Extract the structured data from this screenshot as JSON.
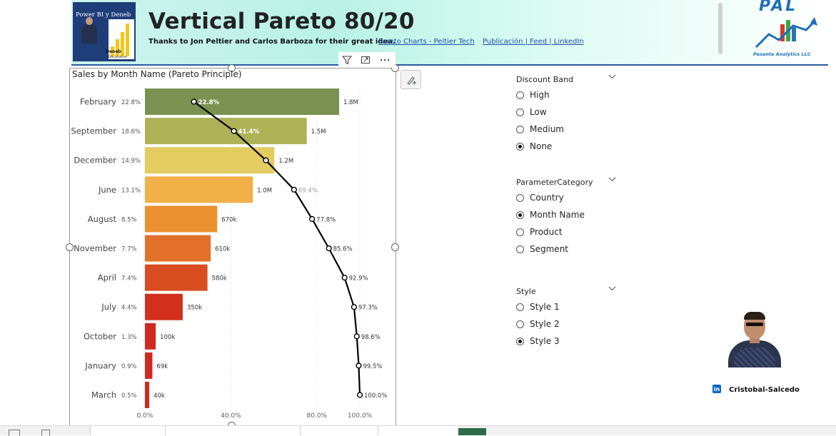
{
  "header": {
    "title": "Vertical Pareto 80/20",
    "subtitle": "Thanks to Jon Peltier and Carlos Barboza for their great idea.",
    "link1": "Pareto Charts - Peltier Tech",
    "link2": "Publicación | Feed | LinkedIn",
    "thumb_title": "Power BI y Deneb",
    "thumb_deneb": "Deneb",
    "thumb_deneb_sub": "Declarative",
    "logo_text": "PAL",
    "logo_sub": "Pesante Analytics LLC"
  },
  "visual": {
    "title": "Sales by Month Name (Pareto Principle)"
  },
  "chart_data": {
    "type": "bar",
    "title": "Sales by Month Name (Pareto Principle)",
    "categories": [
      "February",
      "September",
      "December",
      "June",
      "August",
      "November",
      "April",
      "July",
      "October",
      "January",
      "March"
    ],
    "share_labels": [
      "22.8%",
      "18.6%",
      "14.9%",
      "13.1%",
      "8.5%",
      "7.7%",
      "7.4%",
      "4.4%",
      "1.3%",
      "0.9%",
      "0.5%"
    ],
    "values": [
      1800000,
      1500000,
      1200000,
      1000000,
      670000,
      610000,
      580000,
      350000,
      100000,
      69000,
      40000
    ],
    "value_labels": [
      "1.8M",
      "1.5M",
      "1.2M",
      "1.0M",
      "670k",
      "610k",
      "580k",
      "350k",
      "100k",
      "69k",
      "40k"
    ],
    "cumulative": [
      22.8,
      41.4,
      56.3,
      69.4,
      77.8,
      85.6,
      92.9,
      97.3,
      98.6,
      99.5,
      100.0
    ],
    "cumulative_labels": [
      "22.8%",
      "41.4%",
      "",
      "69.4%",
      "77.8%",
      "85.6%",
      "92.9%",
      "97.3%",
      "98.6%",
      "99.5%",
      "100.0%"
    ],
    "x_ticks": [
      "0.0%",
      "40.0%",
      "80.0%",
      "100.0%"
    ],
    "x_tick_values": [
      0,
      40,
      80,
      100
    ],
    "xlim": [
      0,
      100
    ],
    "grid": true,
    "colors": [
      "#7a9150",
      "#adb257",
      "#e3cc60",
      "#f1b048",
      "#ec9130",
      "#e3702a",
      "#d94e20",
      "#d1301d",
      "#cf2a20",
      "#cf2a20",
      "#cf2a20"
    ],
    "line_color": "#000000"
  },
  "slicers": [
    {
      "label": "Discount Band",
      "options": [
        "High",
        "Low",
        "Medium",
        "None"
      ],
      "selected": 3
    },
    {
      "label": "ParameterCategory",
      "options": [
        "Country",
        "Month Name",
        "Product",
        "Segment"
      ],
      "selected": 1
    },
    {
      "label": "Style",
      "options": [
        "Style 1",
        "Style 2",
        "Style 3"
      ],
      "selected": 2
    }
  ],
  "profile": {
    "name": "Cristobal-Salcedo",
    "linkedin_icon": "in"
  },
  "icons": {
    "filter": "filter-icon",
    "focus": "focus-mode-icon",
    "more": "more-options-icon",
    "format": "format-paintbrush-icon",
    "chevron": "chevron-down-icon"
  }
}
